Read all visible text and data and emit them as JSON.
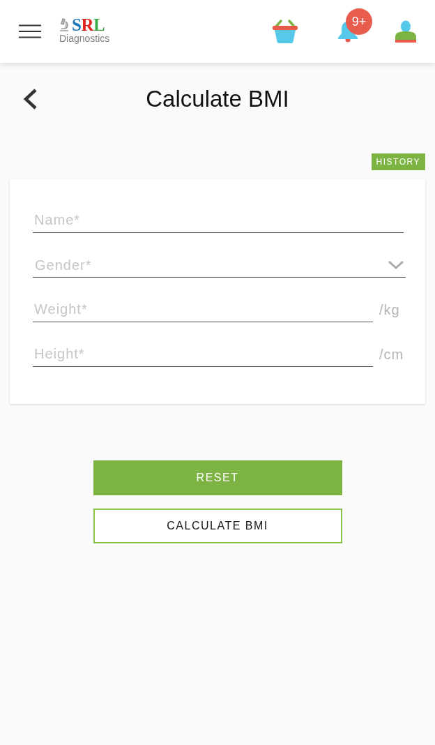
{
  "header": {
    "logo": {
      "brand": "SRL",
      "tagline": "Diagnostics"
    },
    "notification_badge": "9+"
  },
  "page": {
    "title": "Calculate BMI"
  },
  "history_button": "HISTORY",
  "form": {
    "fields": [
      {
        "kind": "text",
        "placeholder": "Name*"
      },
      {
        "kind": "select",
        "placeholder": "Gender*"
      },
      {
        "kind": "unit",
        "placeholder": "Weight*",
        "unit": "/kg"
      },
      {
        "kind": "unit",
        "placeholder": "Height*",
        "unit": "/cm"
      }
    ]
  },
  "buttons": [
    {
      "kind": "primary",
      "label": "RESET"
    },
    {
      "kind": "outline",
      "label": "CALCULATE BMI"
    }
  ]
}
